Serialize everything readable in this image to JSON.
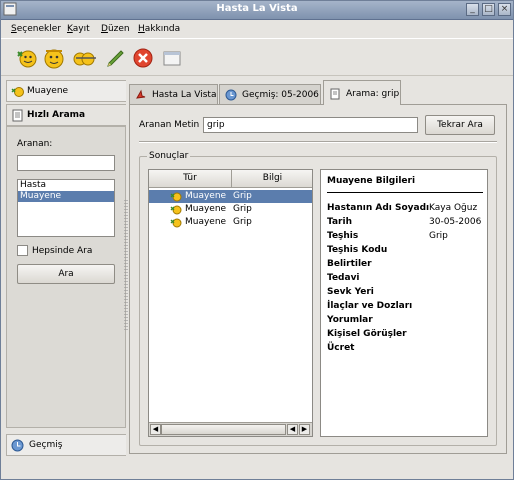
{
  "window": {
    "title": "Hasta La Vista",
    "buttons": [
      "_",
      "□",
      "×"
    ]
  },
  "menu": [
    {
      "label": "Seçenekler",
      "accel": "S"
    },
    {
      "label": "Kayıt",
      "accel": "K"
    },
    {
      "label": "Düzen",
      "accel": "D"
    },
    {
      "label": "Hakkında",
      "accel": "H"
    }
  ],
  "toolbar": {
    "icons": [
      "new-patient-icon",
      "patient-face-icon",
      "search-patients-icon",
      "edit-pencil-icon",
      "delete-x-icon",
      "window-icon"
    ]
  },
  "left": {
    "muayene_header": "Muayene",
    "hizli_arama_header": "Hızlı Arama",
    "aranan_label": "Aranan:",
    "aranan_value": "",
    "list_items": [
      "Hasta",
      "Muayene"
    ],
    "list_selected": 1,
    "hepsinde_label": "Hepsinde Ara",
    "ara_button": "Ara",
    "gecmis_header": "Geçmiş"
  },
  "tabs": [
    {
      "label": "Hasta La Vista",
      "icon": "bookmark-icon"
    },
    {
      "label": "Geçmiş: 05-2006",
      "icon": "history-icon"
    },
    {
      "label": "Arama: grip",
      "icon": "search-tab-icon",
      "active": true
    }
  ],
  "search": {
    "label": "Aranan Metin :",
    "value": "grip",
    "retry_button": "Tekrar Ara"
  },
  "results": {
    "group_label": "Sonuçlar",
    "columns": [
      "Tür",
      "Bilgi"
    ],
    "rows": [
      {
        "type": "Muayene",
        "info": "Grip",
        "selected": true
      },
      {
        "type": "Muayene",
        "info": "Grip",
        "selected": false
      },
      {
        "type": "Muayene",
        "info": "Grip",
        "selected": false
      }
    ]
  },
  "details": {
    "title": "Muayene Bilgileri",
    "fields": [
      {
        "label": "Hastanın Adı Soyadı",
        "value": "Kaya Oğuz"
      },
      {
        "label": "Tarih",
        "value": "30-05-2006"
      },
      {
        "label": "Teşhis",
        "value": "Grip"
      },
      {
        "label": "Teşhis Kodu",
        "value": ""
      },
      {
        "label": "Belirtiler",
        "value": ""
      },
      {
        "label": "Tedavi",
        "value": ""
      },
      {
        "label": "Sevk Yeri",
        "value": ""
      },
      {
        "label": "İlaçlar ve Dozları",
        "value": ""
      },
      {
        "label": "Yorumlar",
        "value": ""
      },
      {
        "label": "Kişisel Görüşler",
        "value": ""
      },
      {
        "label": "Ücret",
        "value": ""
      }
    ]
  },
  "colors": {
    "titlebar": "#8fa0b9",
    "selection": "#5b7dad",
    "window_bg": "#e6e4e0"
  }
}
